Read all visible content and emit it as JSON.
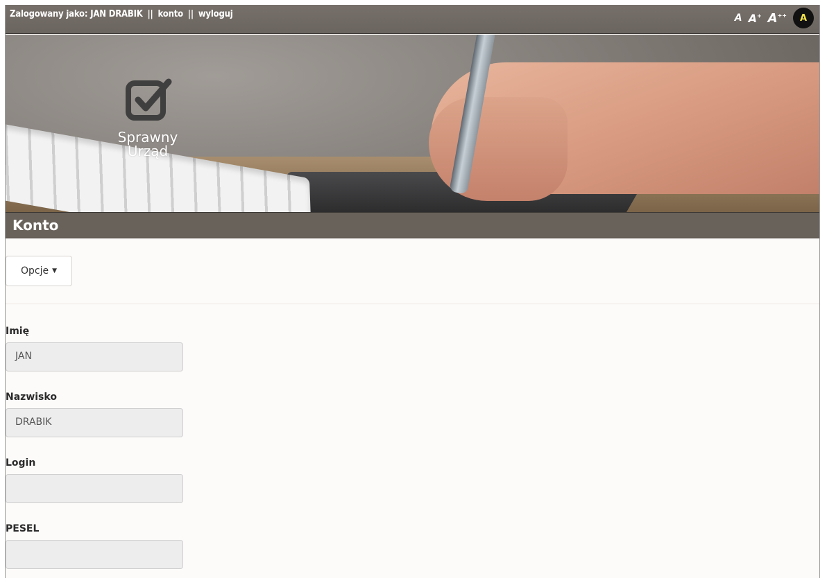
{
  "topbar": {
    "logged_as": "Zalogowany jako: JAN DRABIK",
    "sep1": "||",
    "account_link": "konto",
    "sep2": "||",
    "logout_link": "wyloguj",
    "font_small": "A",
    "font_medium": "A",
    "font_medium_sup": "+",
    "font_large": "A",
    "font_large_sup": "++",
    "contrast": "A"
  },
  "banner": {
    "logo_line1": "Sprawny",
    "logo_line2": "Urząd"
  },
  "page": {
    "title": "Konto"
  },
  "options": {
    "label": "Opcje"
  },
  "form": {
    "first_name": {
      "label": "Imię",
      "value": "JAN"
    },
    "last_name": {
      "label": "Nazwisko",
      "value": "DRABIK"
    },
    "login": {
      "label": "Login",
      "value": ""
    },
    "pesel": {
      "label": "PESEL",
      "value": ""
    }
  },
  "colors": {
    "topbar": "#6f6963",
    "titlebar": "#69625b",
    "contrast_bg": "#111111",
    "contrast_fg": "#f3e44a",
    "input_bg": "#ededed"
  }
}
